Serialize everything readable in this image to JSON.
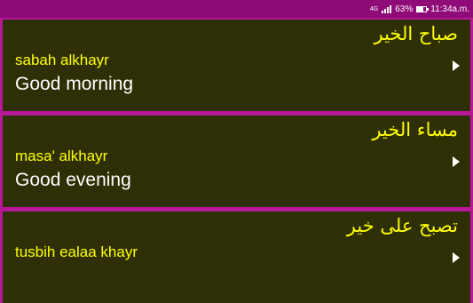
{
  "status_bar": {
    "network": "4G",
    "battery_percent": "63%",
    "battery_level": 0.63,
    "time": "11:34a.m."
  },
  "phrases": [
    {
      "arabic": "صباح الخير",
      "transliteration": "sabah alkhayr",
      "english": "Good morning"
    },
    {
      "arabic": "مساء الخير",
      "transliteration": "masa' alkhayr",
      "english": "Good evening"
    },
    {
      "arabic": "تصبح على خير",
      "transliteration": "tusbih ealaa khayr",
      "english": ""
    }
  ],
  "colors": {
    "status_bar": "#8e0b78",
    "divider": "#b8179a",
    "card_background": "#2f2f05",
    "arabic_text": "#ffff00",
    "transliteration_text": "#ffff00",
    "english_text": "#ffffff"
  },
  "icons": {
    "play": "play-icon"
  }
}
